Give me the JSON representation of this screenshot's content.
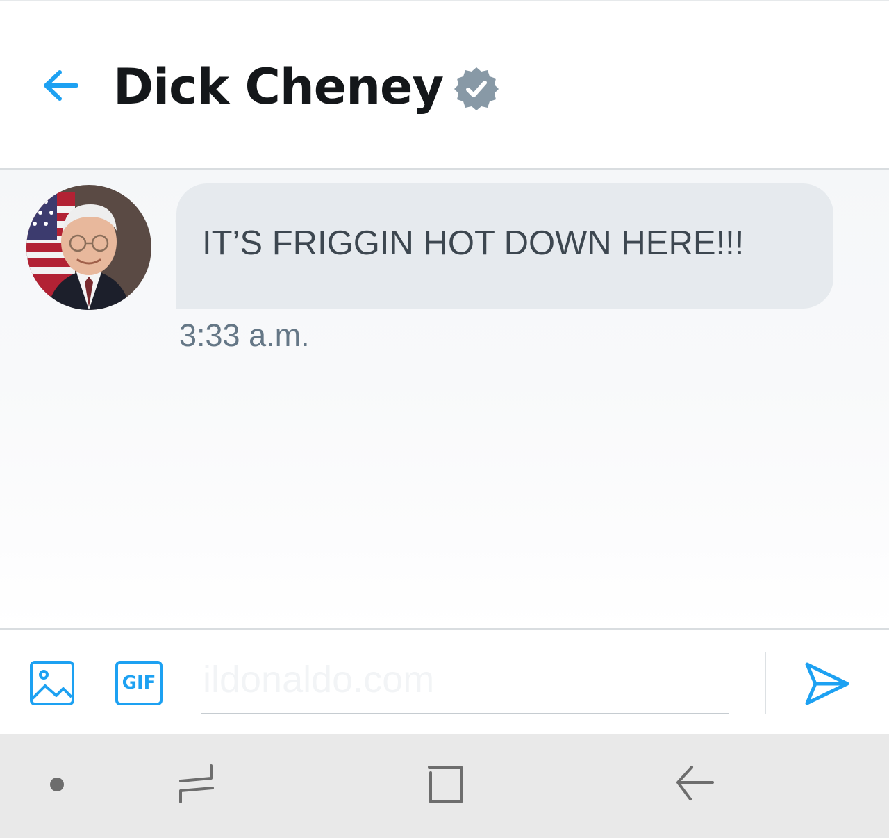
{
  "header": {
    "title": "Dick Cheney",
    "back_icon": "arrow-left-icon",
    "verified_icon": "verified-badge-icon"
  },
  "conversation": {
    "messages": [
      {
        "text": "IT’S FRIGGIN HOT DOWN HERE!!!",
        "time": "3:33 a.m.",
        "avatar_icon": "avatar"
      }
    ]
  },
  "composer": {
    "media_icon": "image-icon",
    "gif_label": "GIF",
    "input_value": "",
    "watermark": "ildonaldo.com",
    "send_icon": "send-icon"
  },
  "navbar": {
    "icons": [
      "dot-icon",
      "recent-apps-icon",
      "home-icon",
      "back-icon"
    ]
  },
  "colors": {
    "accent": "#1da1f2",
    "title": "#14171a",
    "bubble": "#e6eaee",
    "bubble_text": "#3d4750",
    "secondary_text": "#657786",
    "verified": "#8899a6",
    "navbar": "#e9e9e9"
  }
}
